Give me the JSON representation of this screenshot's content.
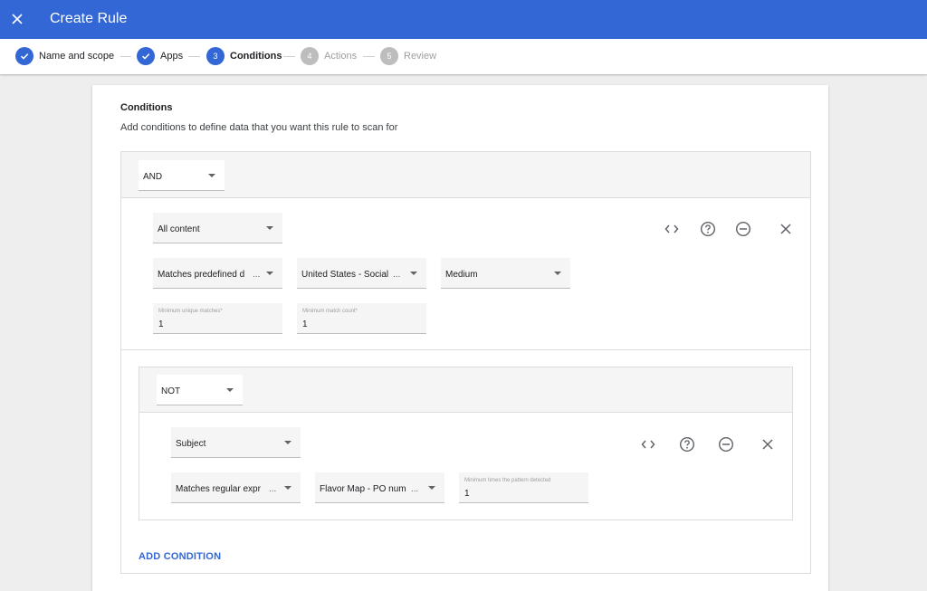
{
  "header": {
    "title": "Create Rule",
    "close_icon": "close-icon"
  },
  "stepper": [
    {
      "label": "Name and scope",
      "state": "done"
    },
    {
      "label": "Apps",
      "state": "done"
    },
    {
      "number": "3",
      "label": "Conditions",
      "state": "active"
    },
    {
      "number": "4",
      "label": "Actions",
      "state": "pending"
    },
    {
      "number": "5",
      "label": "Review",
      "state": "pending"
    }
  ],
  "card": {
    "title": "Conditions",
    "description": "Add conditions to define data that you want this rule to scan for"
  },
  "outer_group": {
    "operator": "AND",
    "condition": {
      "content": "All content",
      "match_type": "Matches predefined d",
      "detector": "United States - Social",
      "likelihood": "Medium",
      "min_unique_label": "Minimum unique matches*",
      "min_unique_value": "1",
      "min_count_label": "Minimum match count*",
      "min_count_value": "1"
    }
  },
  "nested_group": {
    "operator": "NOT",
    "condition": {
      "content": "Subject",
      "match_type": "Matches regular expr",
      "detector": "Flavor Map - PO num",
      "min_times_label": "Minimum times the pattern detected",
      "min_times_value": "1"
    }
  },
  "ellipsis": "...",
  "add_condition": "ADD CONDITION",
  "colors": {
    "primary": "#3367d6",
    "pending": "#bdbdbd",
    "background": "#eeeeee"
  }
}
